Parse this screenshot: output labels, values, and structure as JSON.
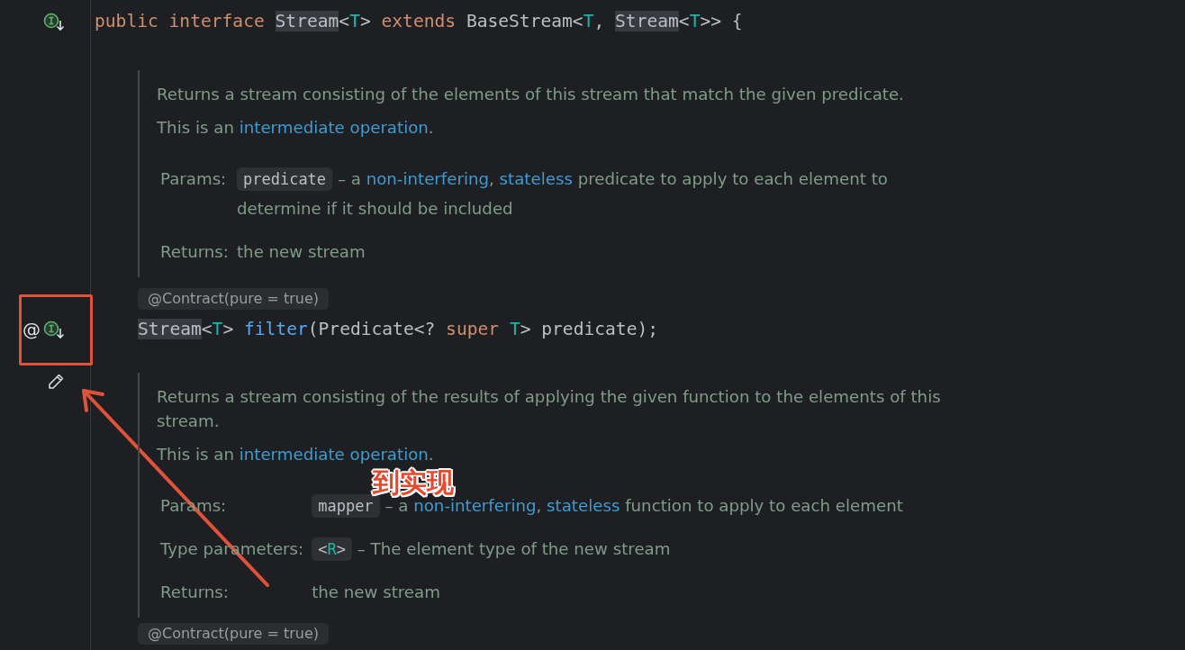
{
  "declaration": {
    "gutter": [
      {
        "kind": "implemented"
      }
    ],
    "tokens": [
      {
        "t": "public interface ",
        "kind": "keyword"
      },
      {
        "t": "Stream",
        "kind": "usage"
      },
      {
        "t": "<",
        "kind": "plain"
      },
      {
        "t": "T",
        "kind": "typeparam"
      },
      {
        "t": "> ",
        "kind": "plain"
      },
      {
        "t": "extends ",
        "kind": "keyword"
      },
      {
        "t": "BaseStream<",
        "kind": "plain"
      },
      {
        "t": "T",
        "kind": "typeparam"
      },
      {
        "t": ", ",
        "kind": "plain"
      },
      {
        "t": "Stream",
        "kind": "usage"
      },
      {
        "t": "<",
        "kind": "plain"
      },
      {
        "t": "T",
        "kind": "typeparam"
      },
      {
        "t": ">> {",
        "kind": "plain"
      }
    ]
  },
  "members": [
    {
      "kind": "doc",
      "paragraphs": [
        [
          {
            "t": "Returns a stream consisting of the elements of this stream that match the given predicate.",
            "link": false
          }
        ],
        [
          {
            "t": "This is an ",
            "link": false
          },
          {
            "t": "intermediate operation",
            "link": true
          },
          {
            "t": ".",
            "link": false
          }
        ]
      ],
      "sections": [
        {
          "label": "Params:",
          "chip": [
            {
              "t": "predicate",
              "kind": "plain"
            }
          ],
          "desc": [
            {
              "t": " – a ",
              "link": false
            },
            {
              "t": "non-interfering",
              "link": true
            },
            {
              "t": ", ",
              "link": false
            },
            {
              "t": "stateless",
              "link": true
            },
            {
              "t": " predicate to apply to each element to determine if it should be included",
              "link": false
            }
          ]
        },
        {
          "label": "Returns:",
          "desc": [
            {
              "t": "the new stream",
              "link": false
            }
          ]
        }
      ]
    },
    {
      "kind": "method",
      "annotation": "@Contract(pure = true)",
      "gutter": [
        {
          "kind": "annotation",
          "glyph": "@"
        },
        {
          "kind": "implemented"
        }
      ],
      "tokens": [
        {
          "t": "Stream",
          "kind": "usage"
        },
        {
          "t": "<",
          "kind": "plain"
        },
        {
          "t": "T",
          "kind": "typeparam"
        },
        {
          "t": "> ",
          "kind": "plain"
        },
        {
          "t": "filter",
          "kind": "method"
        },
        {
          "t": "(Predicate<? ",
          "kind": "plain"
        },
        {
          "t": "super ",
          "kind": "keyword"
        },
        {
          "t": "T",
          "kind": "typeparam"
        },
        {
          "t": "> predicate);",
          "kind": "plain"
        }
      ]
    },
    {
      "kind": "doc",
      "gutter": [
        {
          "kind": "edit"
        }
      ],
      "paragraphs": [
        [
          {
            "t": "Returns a stream consisting of the results of applying the given function to the elements of this stream.",
            "link": false
          }
        ],
        [
          {
            "t": "This is an ",
            "link": false
          },
          {
            "t": "intermediate operation",
            "link": true
          },
          {
            "t": ".",
            "link": false
          }
        ]
      ],
      "sections": [
        {
          "label": "Params:",
          "chip": [
            {
              "t": "mapper",
              "kind": "plain"
            }
          ],
          "desc": [
            {
              "t": " – a ",
              "link": false
            },
            {
              "t": "non-interfering",
              "link": true
            },
            {
              "t": ", ",
              "link": false
            },
            {
              "t": "stateless",
              "link": true
            },
            {
              "t": " function to apply to each element",
              "link": false
            }
          ]
        },
        {
          "label": "Type parameters:",
          "chip": [
            {
              "t": "<",
              "kind": "plain"
            },
            {
              "t": "R",
              "kind": "typeparam"
            },
            {
              "t": ">",
              "kind": "plain"
            }
          ],
          "desc": [
            {
              "t": " – The element type of the new stream",
              "link": false
            }
          ]
        },
        {
          "label": "Returns:",
          "desc": [
            {
              "t": "the new stream",
              "link": false
            }
          ]
        }
      ]
    },
    {
      "kind": "annotation",
      "annotation": "@Contract(pure = true)"
    }
  ],
  "markup": [
    {
      "kind": "frame"
    },
    {
      "kind": "arrow"
    },
    {
      "kind": "label",
      "text": "到实现"
    }
  ]
}
